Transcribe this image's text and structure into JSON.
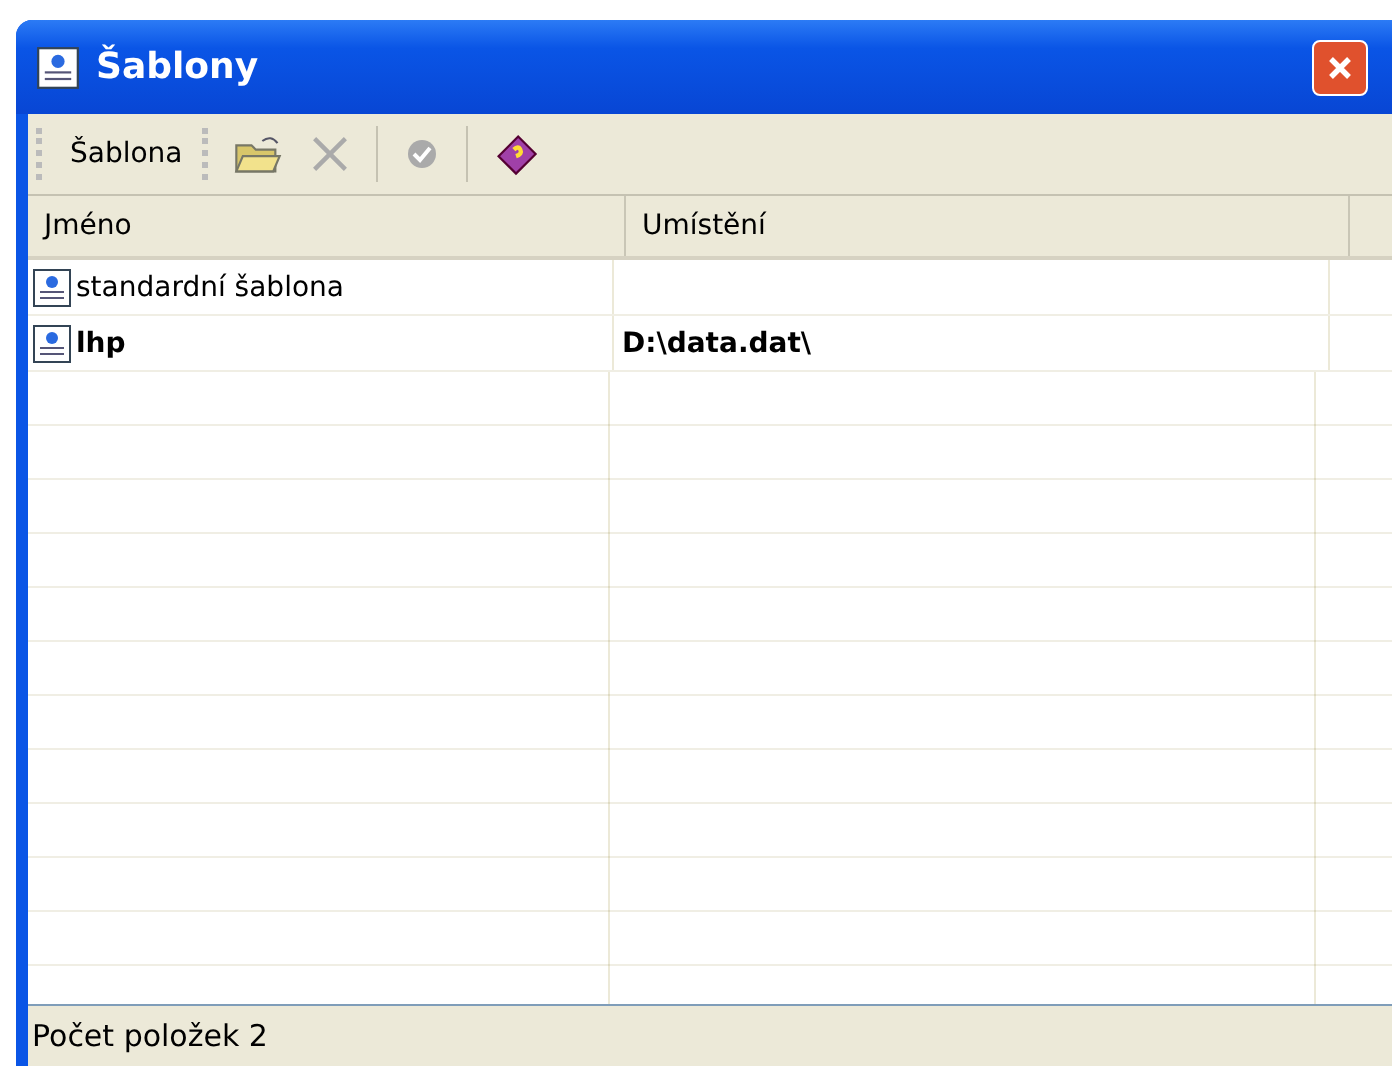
{
  "window": {
    "title": "Šablony"
  },
  "toolbar": {
    "menu_label": "Šablona",
    "buttons": [
      {
        "kind": "open",
        "disabled": false
      },
      {
        "kind": "delete",
        "disabled": true
      },
      {
        "kind": "separator"
      },
      {
        "kind": "apply",
        "disabled": true
      },
      {
        "kind": "separator"
      },
      {
        "kind": "help",
        "disabled": false
      }
    ]
  },
  "table": {
    "columns": [
      "Jméno",
      "Umístění"
    ],
    "rows": [
      {
        "name": "standardní šablona",
        "location": "",
        "bold": false
      },
      {
        "name": "lhp",
        "location": "D:\\data.dat\\",
        "bold": true
      }
    ]
  },
  "status_bar": "Počet položek 2"
}
